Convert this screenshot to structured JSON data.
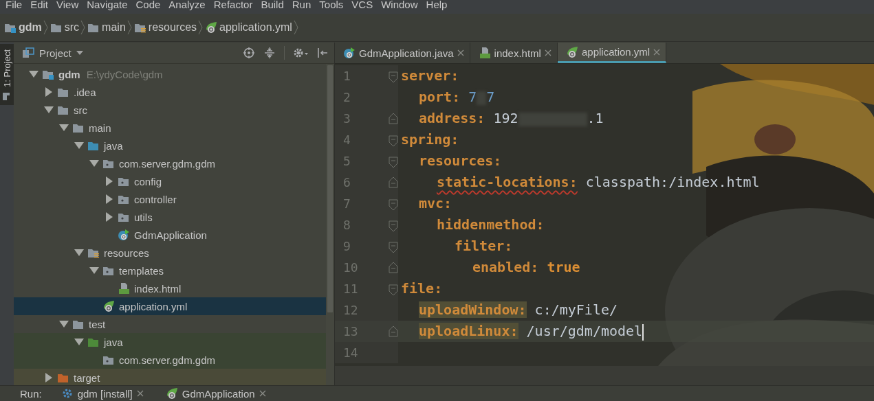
{
  "menu": [
    {
      "label": "File"
    },
    {
      "label": "Edit"
    },
    {
      "label": "View"
    },
    {
      "label": "Navigate"
    },
    {
      "label": "Code"
    },
    {
      "label": "Analyze"
    },
    {
      "label": "Refactor"
    },
    {
      "label": "Build"
    },
    {
      "label": "Run"
    },
    {
      "label": "Tools"
    },
    {
      "label": "VCS"
    },
    {
      "label": "Window"
    },
    {
      "label": "Help"
    }
  ],
  "breadcrumbs": [
    {
      "label": "gdm",
      "kind": "module"
    },
    {
      "label": "src",
      "kind": "folder"
    },
    {
      "label": "main",
      "kind": "folder"
    },
    {
      "label": "resources",
      "kind": "resources"
    },
    {
      "label": "application.yml",
      "kind": "yml"
    }
  ],
  "side_stripe": {
    "label": "1: Project"
  },
  "project": {
    "title": "Project",
    "tree": [
      {
        "label": "gdm",
        "kind": "module",
        "hint": "E:\\ydyCode\\gdm",
        "expanded": true,
        "selected": false,
        "children": [
          {
            "label": ".idea",
            "kind": "folder",
            "expanded": false,
            "selected": false
          },
          {
            "label": "src",
            "kind": "folder",
            "expanded": true,
            "selected": false,
            "children": [
              {
                "label": "main",
                "kind": "folder",
                "expanded": true,
                "selected": false,
                "children": [
                  {
                    "label": "java",
                    "kind": "source",
                    "expanded": true,
                    "selected": false,
                    "children": [
                      {
                        "label": "com.server.gdm.gdm",
                        "kind": "package",
                        "expanded": true,
                        "selected": false,
                        "children": [
                          {
                            "label": "config",
                            "kind": "package",
                            "expanded": false,
                            "selected": false
                          },
                          {
                            "label": "controller",
                            "kind": "package",
                            "expanded": false,
                            "selected": false
                          },
                          {
                            "label": "utils",
                            "kind": "package",
                            "expanded": false,
                            "selected": false
                          },
                          {
                            "label": "GdmApplication",
                            "kind": "spring-class",
                            "selected": false
                          }
                        ]
                      }
                    ]
                  },
                  {
                    "label": "resources",
                    "kind": "resources",
                    "expanded": true,
                    "selected": false,
                    "children": [
                      {
                        "label": "templates",
                        "kind": "package",
                        "expanded": true,
                        "selected": false,
                        "children": [
                          {
                            "label": "index.html",
                            "kind": "html",
                            "selected": false
                          }
                        ]
                      },
                      {
                        "label": "application.yml",
                        "kind": "yml",
                        "selected": true
                      }
                    ]
                  }
                ]
              },
              {
                "label": "test",
                "kind": "folder",
                "expanded": true,
                "selected": false,
                "children": [
                  {
                    "label": "java",
                    "kind": "test-source",
                    "expanded": true,
                    "selected": false,
                    "children": [
                      {
                        "label": "com.server.gdm.gdm",
                        "kind": "test-package",
                        "selected": false
                      }
                    ]
                  }
                ]
              }
            ]
          },
          {
            "label": "target",
            "kind": "excluded",
            "expanded": false,
            "selected": false
          }
        ]
      }
    ]
  },
  "editor": {
    "tabs": [
      {
        "label": "GdmApplication.java",
        "kind": "spring-class",
        "selected": false
      },
      {
        "label": "index.html",
        "kind": "html",
        "selected": false
      },
      {
        "label": "application.yml",
        "kind": "yml",
        "selected": true
      }
    ],
    "lines": [
      {
        "number": "1",
        "kind": "fold-start",
        "current": false,
        "tokens": [
          {
            "kind": "key",
            "text": "server:"
          }
        ],
        "children": [
          {
            "number": "2",
            "kind": "plain",
            "current": false,
            "tokens": [
              {
                "kind": "key",
                "text": "port:"
              },
              {
                "kind": "number",
                "text": "7"
              },
              {
                "kind": "redacted"
              },
              {
                "kind": "number",
                "text": "7"
              }
            ]
          },
          {
            "number": "3",
            "kind": "fold-end",
            "current": false,
            "tokens": [
              {
                "kind": "key",
                "text": "address:"
              },
              {
                "kind": "value",
                "text": "192"
              },
              {
                "kind": "redacted"
              },
              {
                "kind": "value",
                "text": ".1"
              }
            ]
          }
        ]
      },
      {
        "number": "4",
        "kind": "fold-start",
        "current": false,
        "tokens": [
          {
            "kind": "key",
            "text": "spring:"
          }
        ],
        "children": [
          {
            "number": "5",
            "kind": "fold-start",
            "current": false,
            "tokens": [
              {
                "kind": "key",
                "text": "resources:"
              }
            ],
            "children": [
              {
                "number": "6",
                "kind": "fold-end",
                "current": false,
                "tokens": [
                  {
                    "kind": "key-warning",
                    "text": "static-locations:"
                  },
                  {
                    "kind": "value",
                    "text": "classpath:/index.html"
                  }
                ]
              }
            ]
          },
          {
            "number": "7",
            "kind": "fold-start",
            "current": false,
            "tokens": [
              {
                "kind": "key",
                "text": "mvc:"
              }
            ],
            "children": [
              {
                "number": "8",
                "kind": "fold-start",
                "current": false,
                "tokens": [
                  {
                    "kind": "key",
                    "text": "hiddenmethod:"
                  }
                ],
                "children": [
                  {
                    "number": "9",
                    "kind": "fold-start",
                    "current": false,
                    "tokens": [
                      {
                        "kind": "key",
                        "text": "filter:"
                      }
                    ],
                    "children": [
                      {
                        "number": "10",
                        "kind": "fold-end",
                        "current": false,
                        "tokens": [
                          {
                            "kind": "key",
                            "text": "enabled:"
                          },
                          {
                            "kind": "bool",
                            "text": "true"
                          }
                        ]
                      }
                    ]
                  }
                ]
              }
            ]
          }
        ]
      },
      {
        "number": "11",
        "kind": "fold-start",
        "current": false,
        "tokens": [
          {
            "kind": "key",
            "text": "file:"
          }
        ],
        "children": [
          {
            "number": "12",
            "kind": "plain",
            "current": false,
            "tokens": [
              {
                "kind": "key-highlight",
                "text": "uploadWindow:"
              },
              {
                "kind": "value",
                "text": "c:/myFile/"
              }
            ]
          },
          {
            "number": "13",
            "kind": "fold-end",
            "current": true,
            "tokens": [
              {
                "kind": "key-highlight",
                "text": "uploadLinux:"
              },
              {
                "kind": "value",
                "text": "/usr/gdm/model"
              }
            ]
          }
        ]
      },
      {
        "number": "14",
        "kind": "plain",
        "current": false
      }
    ]
  },
  "run_bar": {
    "label": "Run:",
    "tabs": [
      {
        "label": "gdm [install]",
        "kind": "maven"
      },
      {
        "label": "GdmApplication",
        "kind": "spring"
      }
    ]
  }
}
